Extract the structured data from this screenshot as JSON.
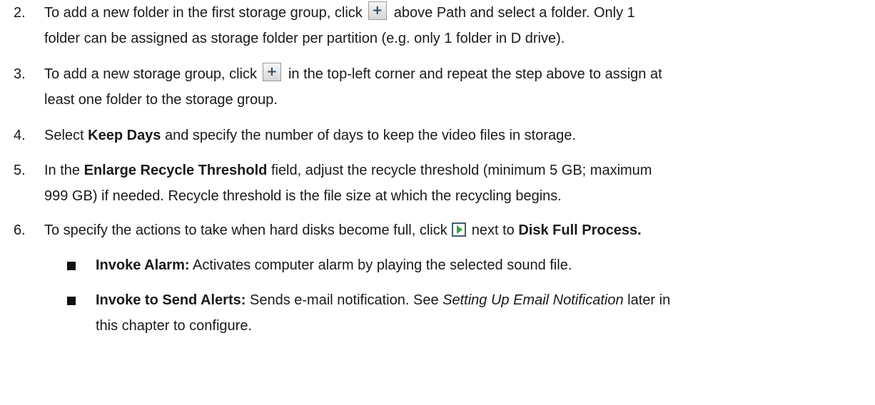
{
  "steps": [
    {
      "num": "2.",
      "parts": {
        "a": "To add a new folder in the first storage group, click",
        "b": "above Path and select a folder. Only 1",
        "c": "folder can be assigned as storage folder per partition (e.g. only 1 folder in D drive)."
      }
    },
    {
      "num": "3.",
      "parts": {
        "a": "To add a new storage group, click",
        "b": "in the top-left corner and repeat the step above to assign at",
        "c": "least one folder to the storage group."
      }
    },
    {
      "num": "4.",
      "parts": {
        "a": "Select",
        "b": "Keep Days",
        "c": "and specify the number of days to keep the video files in storage."
      }
    },
    {
      "num": "5.",
      "parts": {
        "a": "In the",
        "b": "Enlarge Recycle Threshold",
        "c": "field, adjust the recycle threshold (minimum 5 GB; maximum",
        "d": "999 GB) if needed. Recycle threshold is the file size at which the recycling begins."
      }
    },
    {
      "num": "6.",
      "parts": {
        "a": "To specify the actions to take when hard disks become full, click",
        "b": "next to",
        "c": "Disk Full Process",
        "d": "."
      }
    }
  ],
  "bullets": [
    {
      "term": "Invoke Alarm:",
      "desc": "Activates computer alarm by playing the selected sound file."
    },
    {
      "term": "Invoke to Send Alerts:",
      "desc1": "Sends e-mail notification. See",
      "ref": "Setting Up Email Notification",
      "desc2": "later in",
      "desc3": "this chapter to configure."
    }
  ],
  "icons": {
    "add": "plus-icon",
    "next": "play-arrow-icon",
    "bullet": "square-bullet-icon"
  }
}
